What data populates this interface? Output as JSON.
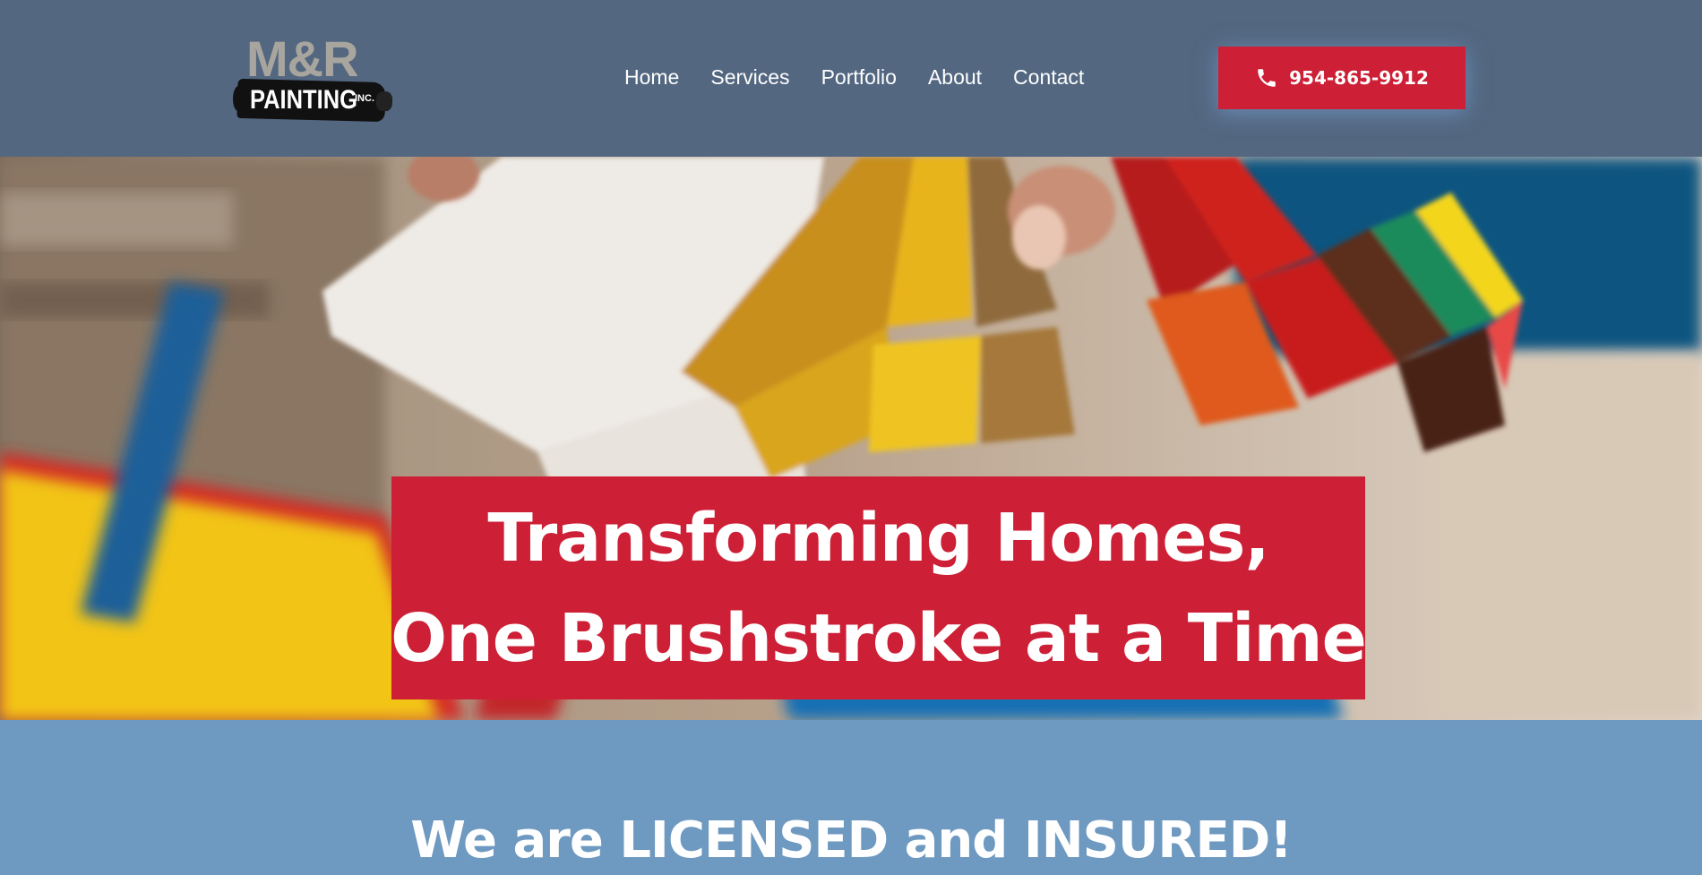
{
  "logo": {
    "top": "M&R",
    "bottom": "PAINTING",
    "suffix": "INC."
  },
  "nav": {
    "items": [
      {
        "label": "Home"
      },
      {
        "label": "Services"
      },
      {
        "label": "Portfolio"
      },
      {
        "label": "About"
      },
      {
        "label": "Contact"
      }
    ]
  },
  "phone": {
    "label": "954-865-9912",
    "icon": "phone-icon"
  },
  "hero": {
    "line1": "Transforming Homes,",
    "line2": "One Brushstroke at a Time"
  },
  "band": {
    "title": "We are LICENSED and INSURED!"
  },
  "colors": {
    "header": "#536780",
    "accent": "#cd1f35",
    "band": "#6e99c0"
  }
}
